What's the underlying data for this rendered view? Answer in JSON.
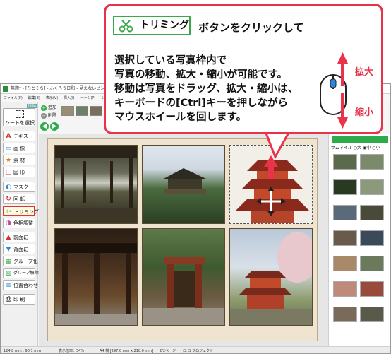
{
  "window": {
    "title": "無題* - [ひとくち] - ふくろう日和 - 見えないピンクの日 ",
    "menu": [
      "ファイル(F)",
      "編集(E)",
      "表示(V)",
      "挿入(I)",
      "ページ(P)",
      "ツール(T)",
      "ヘルプ(H)"
    ]
  },
  "left_panel": {
    "version_label": "ISSa",
    "sheet_select": "シートを選択",
    "tools": [
      {
        "label": "テキスト",
        "icon": "text-a-icon"
      },
      {
        "label": "画 像",
        "icon": "image-icon"
      },
      {
        "label": "素 材",
        "icon": "star-icon"
      },
      {
        "label": "図 形",
        "icon": "shape-icon"
      },
      {
        "label": "マスク",
        "icon": "mask-icon"
      },
      {
        "label": "回 転",
        "icon": "rotate-icon"
      },
      {
        "label": "トリミング",
        "icon": "scissors-icon"
      },
      {
        "label": "色相調整",
        "icon": "color-adjust-icon"
      },
      {
        "label": "前面に",
        "icon": "bring-front-icon"
      },
      {
        "label": "背面に",
        "icon": "send-back-icon"
      },
      {
        "label": "グループ化",
        "icon": "group-icon"
      },
      {
        "label": "グループ解除",
        "icon": "ungroup-icon"
      },
      {
        "label": "位置合わせ",
        "icon": "align-icon"
      },
      {
        "label": "印 刷",
        "icon": "print-icon"
      }
    ]
  },
  "toolbar": {
    "add_label": "追加",
    "delete_label": "削除"
  },
  "right_panel": {
    "thumb_label": "サムネイル",
    "size_options": "○大 ◉中 ○小"
  },
  "status_bar": {
    "coords": "124.8 mm ; 90.1 mm",
    "zoom": "表示倍率：34%",
    "paper": "A4 横 [297.0 mm x 210.0 mm]",
    "page": "2/2ページ",
    "layer": "ロ.ロ プロジェクト"
  },
  "callout": {
    "button_label": "トリミング",
    "title": "ボタンをクリックして",
    "body": [
      "選択している写真枠内で",
      "写真の移動、拡大・縮小が可能です。",
      "移動は写真をドラッグ、拡大・縮小は、",
      "キーボードの[Ctrl]キーを押しながら",
      "マウスホイールを回します。"
    ],
    "zoom_in": "拡大",
    "zoom_out": "縮小"
  },
  "colors": {
    "accent_red": "#e8334a",
    "accent_green": "#3aa84a"
  }
}
